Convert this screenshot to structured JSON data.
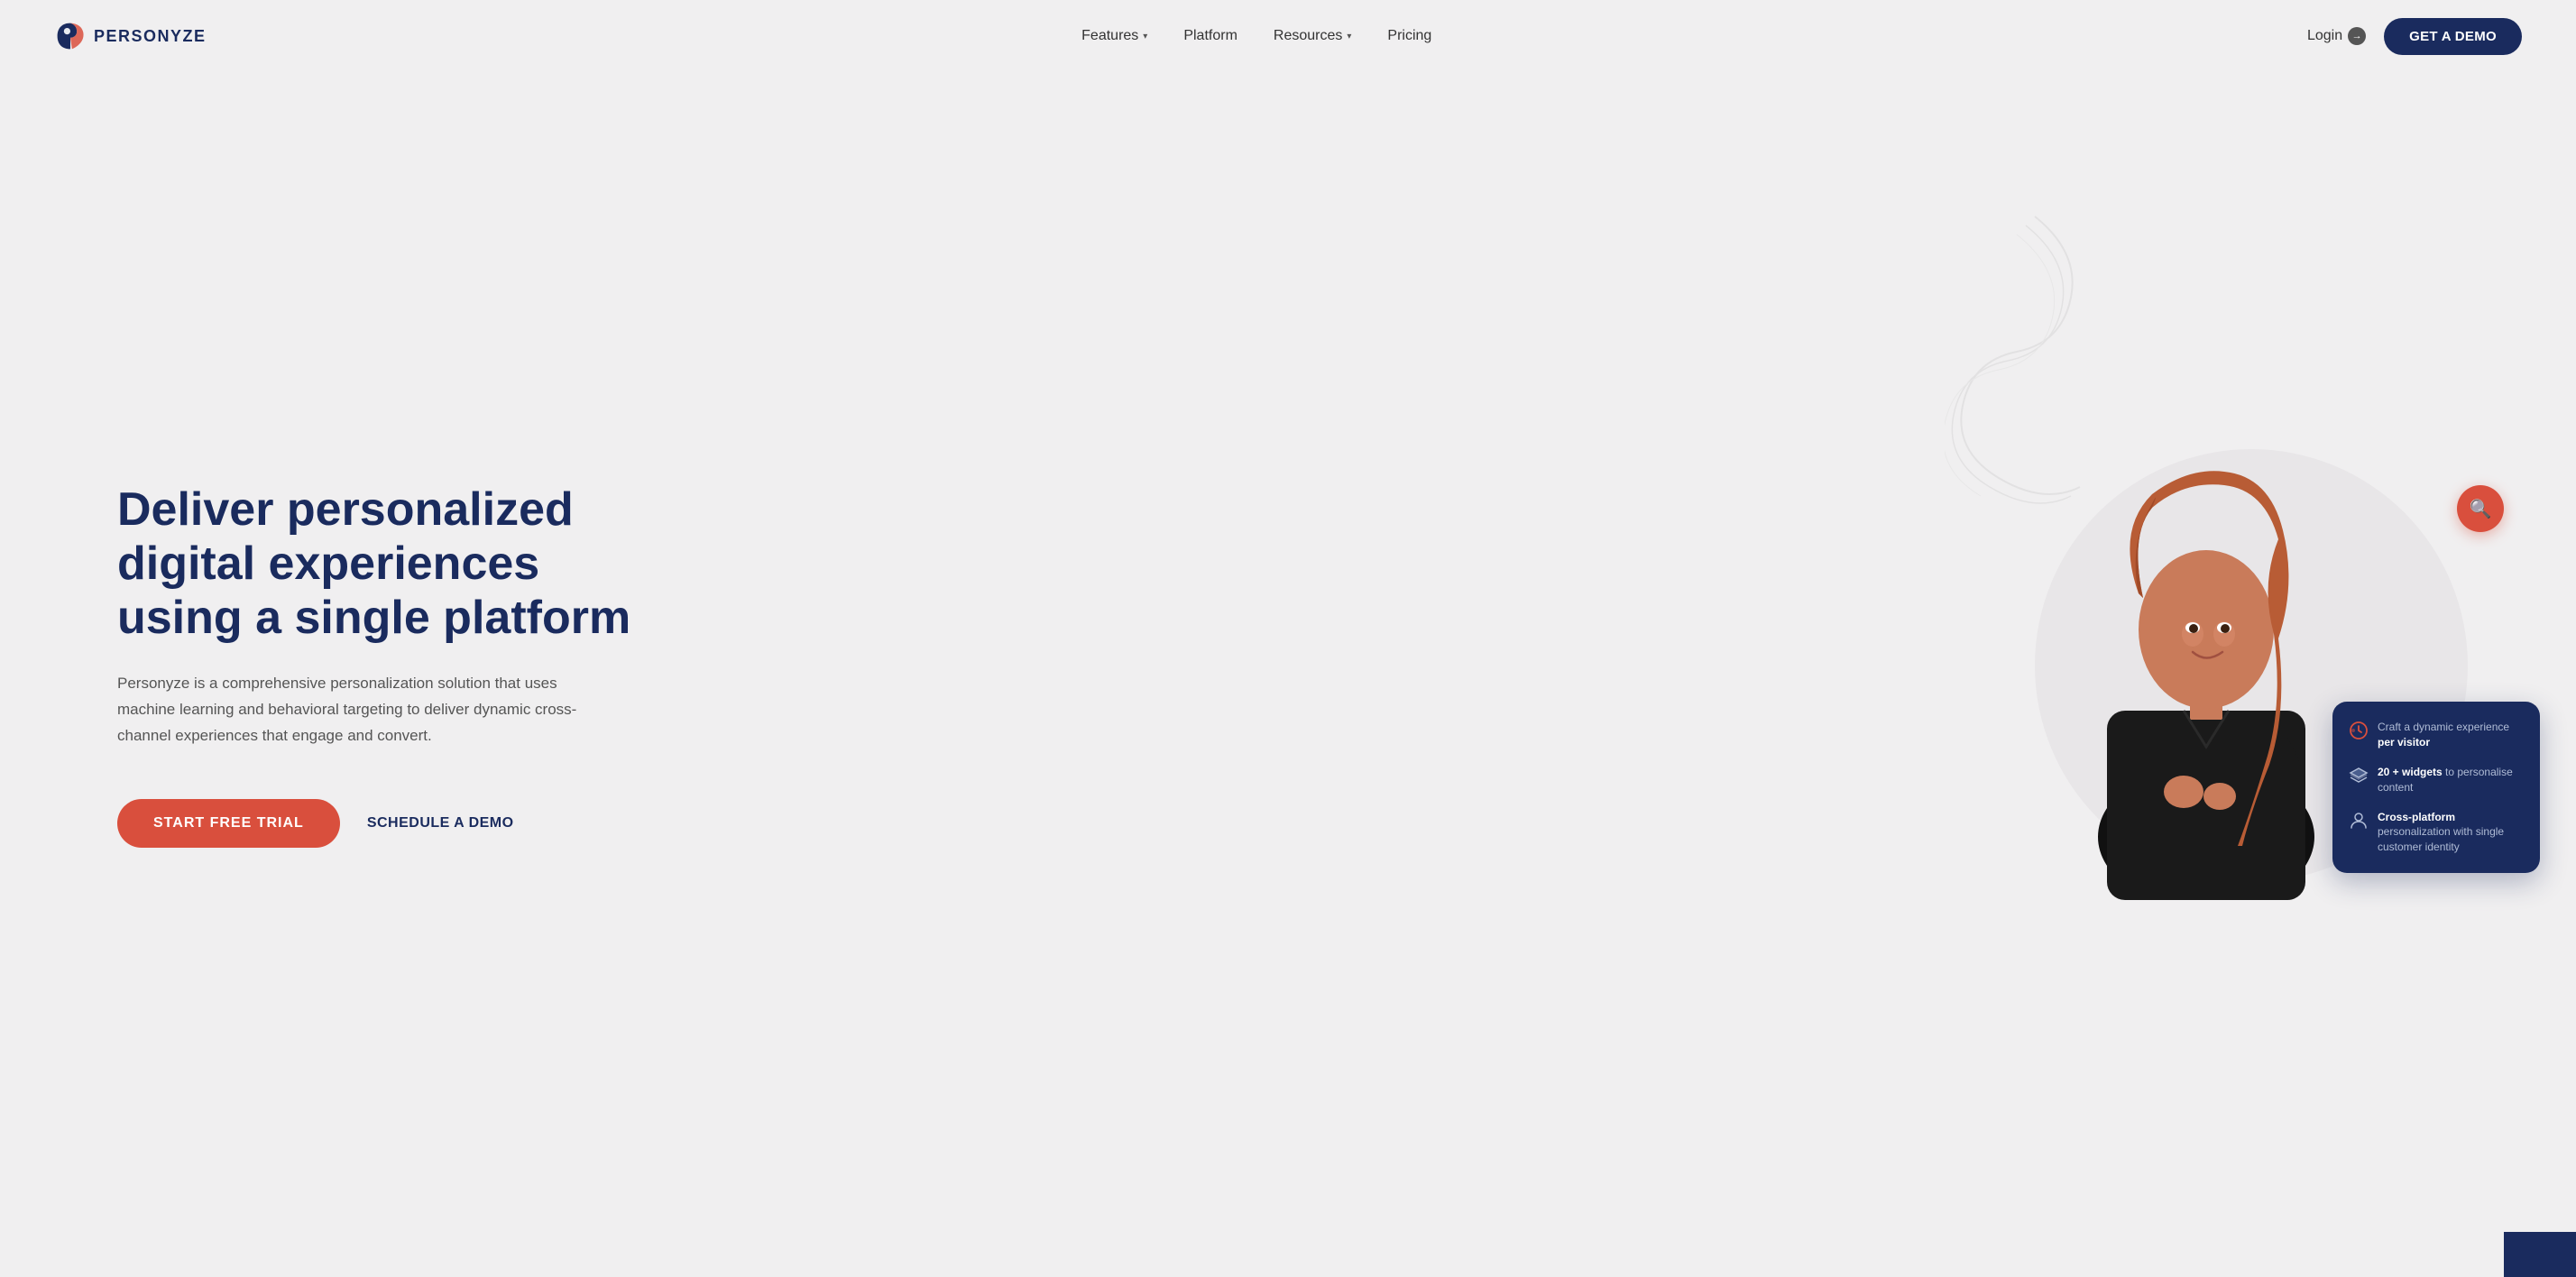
{
  "brand": {
    "name": "PERSONYZE",
    "logo_alt": "Personyze Logo"
  },
  "nav": {
    "links": [
      {
        "label": "Features",
        "has_dropdown": true
      },
      {
        "label": "Platform",
        "has_dropdown": false
      },
      {
        "label": "Resources",
        "has_dropdown": true
      },
      {
        "label": "Pricing",
        "has_dropdown": false
      }
    ],
    "login_label": "Login",
    "demo_button_label": "GET A DEMO"
  },
  "hero": {
    "title": "Deliver personalized digital experiences using a single platform",
    "description": "Personyze is a comprehensive personalization solution that uses machine learning and behavioral targeting to deliver dynamic cross-channel experiences that engage and convert.",
    "cta_primary": "START FREE TRIAL",
    "cta_secondary": "SCHEDULE A DEMO"
  },
  "info_card": {
    "items": [
      {
        "icon": "clock-icon",
        "text_bold": "",
        "text_before": "Craft a dynamic experience ",
        "text_highlight": "per visitor",
        "text_after": ""
      },
      {
        "icon": "layers-icon",
        "text_bold": "20 + widgets",
        "text_before": "",
        "text_highlight": "",
        "text_after": " to personalise content"
      },
      {
        "icon": "user-icon",
        "text_bold": "Cross-platform",
        "text_before": "",
        "text_highlight": "",
        "text_after": " personalization with single customer identity"
      }
    ]
  },
  "colors": {
    "brand_dark": "#1a2b5e",
    "accent_red": "#d94f3d",
    "background": "#f0eff0",
    "text_muted": "#555555"
  }
}
